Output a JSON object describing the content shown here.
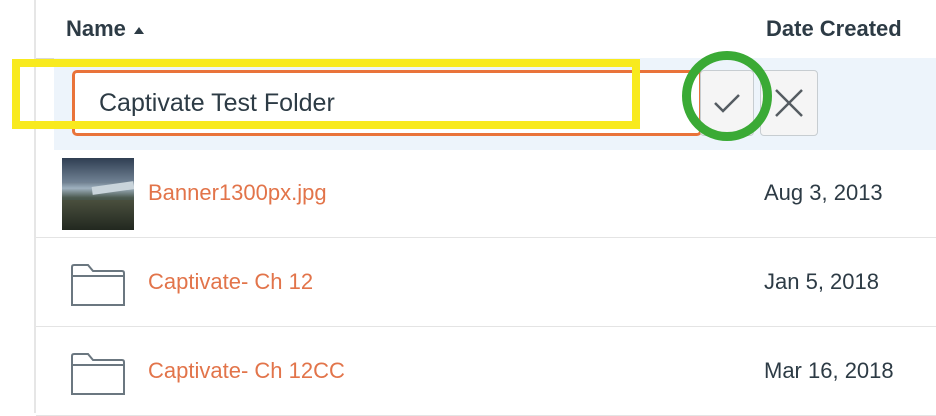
{
  "header": {
    "name_label": "Name",
    "date_label": "Date Created"
  },
  "rename": {
    "value": "Captivate Test Folder",
    "confirm_icon": "checkmark-icon",
    "cancel_icon": "close-icon"
  },
  "files": [
    {
      "name": "Banner1300px.jpg",
      "date": "Aug 3, 2013",
      "icon": "image-thumbnail"
    },
    {
      "name": "Captivate- Ch 12",
      "date": "Jan 5, 2018",
      "icon": "folder-icon"
    },
    {
      "name": "Captivate- Ch 12CC",
      "date": "Mar 16, 2018",
      "icon": "folder-icon"
    }
  ],
  "colors": {
    "link": "#e2744a",
    "input_border": "#e9733a",
    "edit_row_bg": "#edf4fb",
    "highlight_yellow": "#f8ea1e",
    "highlight_green": "#3aaa35"
  }
}
